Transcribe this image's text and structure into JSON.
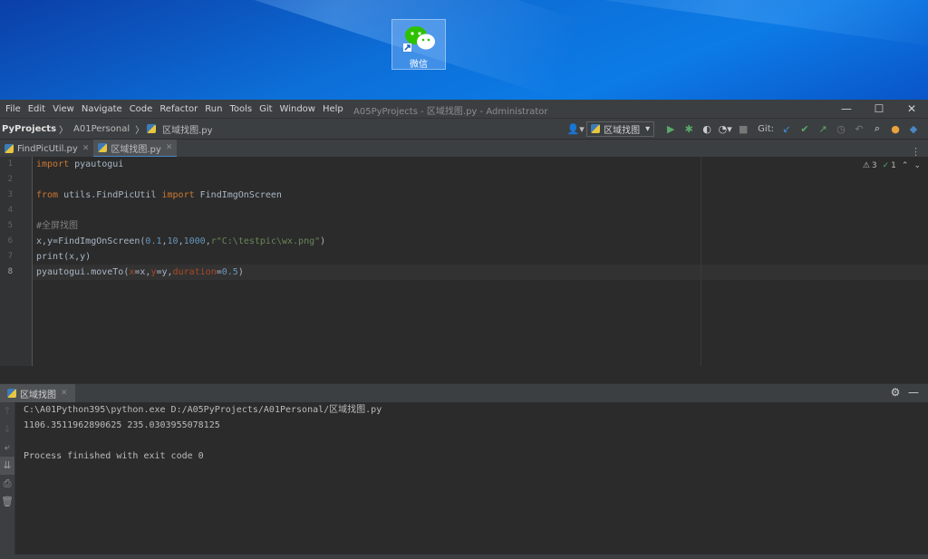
{
  "desktop": {
    "icon_label": "微信"
  },
  "window": {
    "menu": [
      "File",
      "Edit",
      "View",
      "Navigate",
      "Code",
      "Refactor",
      "Run",
      "Tools",
      "Git",
      "Window",
      "Help"
    ],
    "title": "A05PyProjects - 区域找图.py - Administrator",
    "minimize": "—",
    "maximize": "☐",
    "close": "✕"
  },
  "navbar": {
    "project": "PyProjects",
    "sep": "〉",
    "folder": "A01Personal",
    "file": "区域找图.py",
    "run_config": "区域找图",
    "git_label": "Git:"
  },
  "tabs": [
    {
      "label": "FindPicUtil.py",
      "close": "✕"
    },
    {
      "label": "区域找图.py",
      "close": "✕"
    }
  ],
  "editor": {
    "line_numbers": [
      "1",
      "2",
      "3",
      "4",
      "5",
      "6",
      "7",
      "8"
    ],
    "inspections": {
      "warnings": "3",
      "checks": "1"
    },
    "code": {
      "l1_kw": "import",
      "l1_rest": " pyautogui",
      "l3_kw1": "from",
      "l3_mid": " utils.FindPicUtil ",
      "l3_kw2": "import",
      "l3_rest": " FindImgOnScreen",
      "l5_comment": "#全屏找图",
      "l6_a": "x,y=FindImgOnScreen(",
      "l6_n1": "0.1",
      "l6_c1": ",",
      "l6_n2": "10",
      "l6_c2": ",",
      "l6_n3": "1000",
      "l6_c3": ",",
      "l6_str": "r\"C:\\testpic\\wx.png\"",
      "l6_end": ")",
      "l7": "print(x,y)",
      "l8_a": "pyautogui.moveTo(",
      "l8_p1": "x",
      "l8_b": "=x,",
      "l8_p2": "y",
      "l8_c": "=y,",
      "l8_p3": "duration",
      "l8_d": "=",
      "l8_n": "0.5",
      "l8_e": ")"
    }
  },
  "run": {
    "tab_label": "区域找图",
    "output": [
      "C:\\A01Python395\\python.exe D:/A05PyProjects/A01Personal/区域找图.py",
      "1106.3511962890625 235.0303955078125",
      "",
      "Process finished with exit code 0"
    ]
  }
}
